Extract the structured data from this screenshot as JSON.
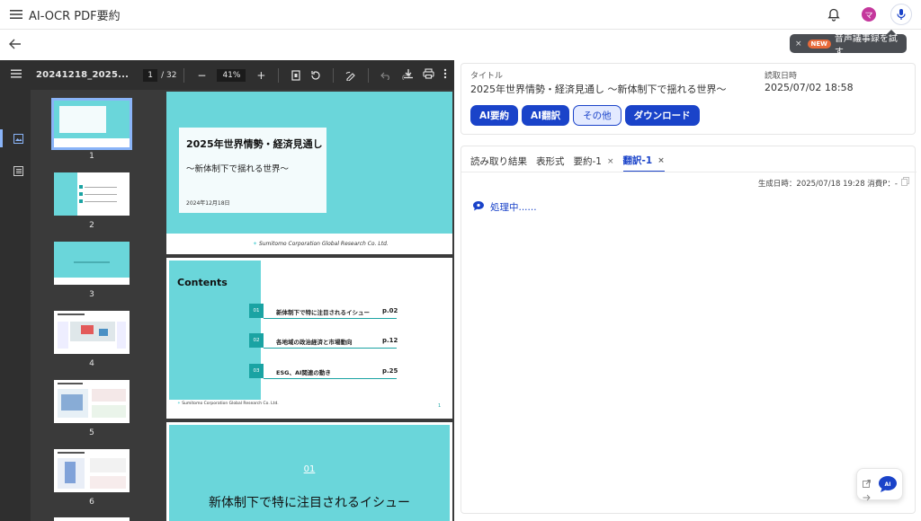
{
  "app": {
    "title": "AI-OCR PDF要約",
    "avatar_letter": "マ"
  },
  "tooltip": {
    "close": "×",
    "badge": "NEW",
    "text": "音声議事録を試す"
  },
  "viewer": {
    "filename": "20241218_2025...",
    "page_current": "1",
    "page_total": "/ 32",
    "zoom": "41%",
    "zoom_minus": "−",
    "zoom_plus": "+",
    "thumbnails": [
      {
        "num": "1"
      },
      {
        "num": "2"
      },
      {
        "num": "3"
      },
      {
        "num": "4"
      },
      {
        "num": "5"
      },
      {
        "num": "6"
      }
    ],
    "page1": {
      "title": "2025年世界情勢・経済見通し",
      "subtitle": "～新体制下で揺れる世界～",
      "date": "2024年12月18日",
      "footer": "Sumitomo Corporation Global Research Co. Ltd."
    },
    "page2": {
      "heading": "Contents",
      "items": [
        {
          "no": "01",
          "text": "新体制下で特に注目されるイシュー",
          "page": "p.02"
        },
        {
          "no": "02",
          "text": "各地域の政治経済と市場動向",
          "page": "p.12"
        },
        {
          "no": "03",
          "text": "ESG、AI関連の動き",
          "page": "p.25"
        }
      ],
      "footer": "Sumitomo Corporation Global Research Co. Ltd.",
      "page_no": "1"
    },
    "page3": {
      "num": "01",
      "title": "新体制下で特に注目されるイシュー"
    }
  },
  "info": {
    "title_label": "タイトル",
    "title_value": "2025年世界情勢・経済見通し ～新体制下で揺れる世界～",
    "date_label": "読取日時",
    "date_value": "2025/07/02 18:58",
    "buttons": [
      "AI要約",
      "AI翻訳",
      "その他",
      "ダウンロード"
    ]
  },
  "result": {
    "tabs": [
      {
        "label": "読み取り結果"
      },
      {
        "label": "表形式"
      },
      {
        "label": "要約-1",
        "close": "×"
      },
      {
        "label": "翻訳-1",
        "close": "×"
      }
    ],
    "meta": "生成日時：2025/07/18 19:28  消費P：-",
    "processing": "処理中......"
  },
  "colors": {
    "accent": "#1a43c9",
    "teal": "#6ad6da",
    "viewer_bg": "#3a3a3a"
  }
}
